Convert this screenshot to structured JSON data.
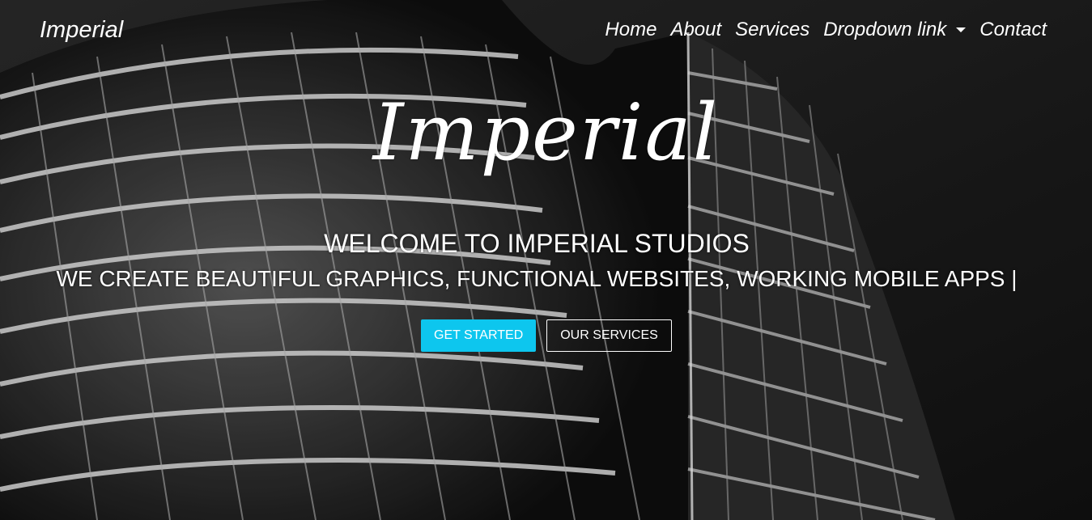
{
  "navbar": {
    "brand": "Imperial",
    "links": [
      {
        "label": "Home"
      },
      {
        "label": "About"
      },
      {
        "label": "Services"
      },
      {
        "label": "Dropdown link"
      },
      {
        "label": "Contact"
      }
    ]
  },
  "hero": {
    "script_title": "Imperial",
    "welcome": "WELCOME TO IMPERIAL STUDIOS",
    "tagline": "WE CREATE BEAUTIFUL GRAPHICS, FUNCTIONAL WEBSITES, WORKING MOBILE APPS |",
    "primary_button": "GET STARTED",
    "secondary_button": "OUR SERVICES",
    "accent_color": "#0dc6ee"
  },
  "icons": {
    "dropdown": "chevron-down-icon"
  }
}
